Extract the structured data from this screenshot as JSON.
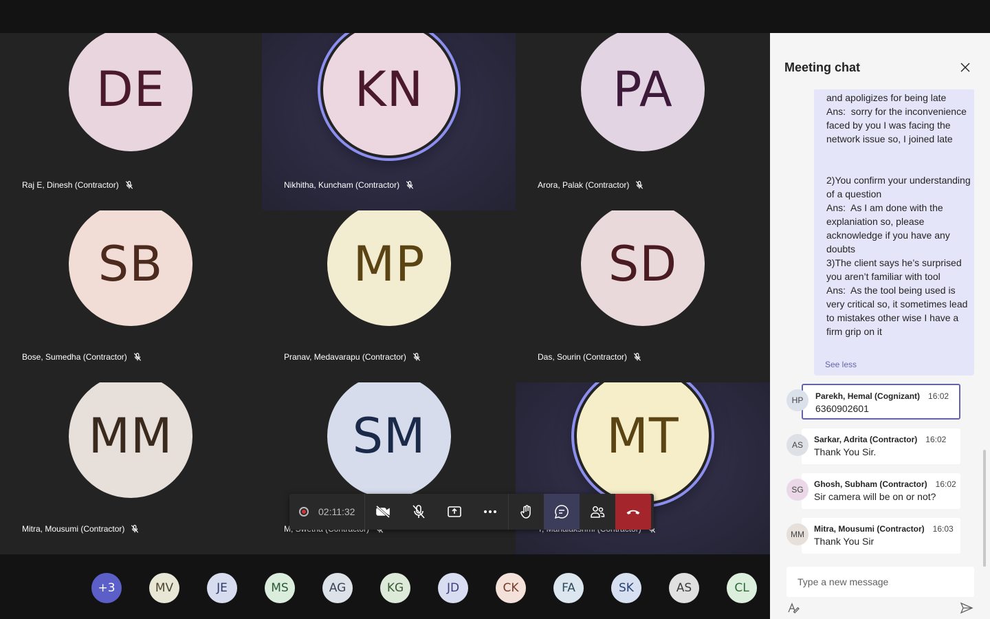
{
  "tiles": [
    {
      "initials": "DE",
      "name": "Raj E, Dinesh (Contractor)",
      "bg": "#e8d5de",
      "fg": "#4a1a2c"
    },
    {
      "initials": "KN",
      "name": "Nikhitha, Kuncham (Contractor)",
      "bg": "#ecd7e1",
      "fg": "#4a1a2c",
      "speaking": true
    },
    {
      "initials": "PA",
      "name": "Arora, Palak (Contractor)",
      "bg": "#e3d4e4",
      "fg": "#3d1a3a"
    },
    {
      "initials": "SB",
      "name": "Bose, Sumedha (Contractor)",
      "bg": "#f2ddd6",
      "fg": "#4d2a1e"
    },
    {
      "initials": "MP",
      "name": "Pranav, Medavarapu (Contractor)",
      "bg": "#f2ecd0",
      "fg": "#5a4413"
    },
    {
      "initials": "SD",
      "name": "Das, Sourin (Contractor)",
      "bg": "#ead9da",
      "fg": "#4a1c22"
    },
    {
      "initials": "MM",
      "name": "Mitra, Mousumi (Contractor)",
      "bg": "#e6dfda",
      "fg": "#3a2a1e"
    },
    {
      "initials": "SM",
      "name": "M, Swetha (Contractor)",
      "bg": "#d6dcec",
      "fg": "#1c2a4a"
    },
    {
      "initials": "MT",
      "name": "T, Mahalakshmi (Contractor)",
      "bg": "#f5eec8",
      "fg": "#5a4413",
      "speaking": true
    }
  ],
  "call_controls": {
    "timer": "02:11:32"
  },
  "roster": [
    {
      "label": "+3",
      "bg": "#5b5fc7",
      "fg": "#ffffff"
    },
    {
      "label": "MV",
      "bg": "#e8e6d5",
      "fg": "#4a4430"
    },
    {
      "label": "JE",
      "bg": "#d8dcef",
      "fg": "#2c3a6a"
    },
    {
      "label": "MS",
      "bg": "#dbeede",
      "fg": "#2d5a36"
    },
    {
      "label": "AG",
      "bg": "#dde1e8",
      "fg": "#3a4454"
    },
    {
      "label": "KG",
      "bg": "#dde9d9",
      "fg": "#3a5a32"
    },
    {
      "label": "JD",
      "bg": "#d9ddf2",
      "fg": "#3a3f7a"
    },
    {
      "label": "CK",
      "bg": "#f3e1da",
      "fg": "#7a3a28"
    },
    {
      "label": "FA",
      "bg": "#dbe6ee",
      "fg": "#2e4a5e"
    },
    {
      "label": "SK",
      "bg": "#d6e0f0",
      "fg": "#2a4272"
    },
    {
      "label": "AS",
      "bg": "#e0e0e0",
      "fg": "#3c3c3c"
    },
    {
      "label": "CL",
      "bg": "#dcefdc",
      "fg": "#2e6a3a"
    }
  ],
  "chat": {
    "title": "Meeting chat",
    "self_message": "and apoligizes for being late\nAns:  sorry for the inconvenience faced by you I was facing the network issue so, I joined late\n\n\n2)You confirm your understanding of a question\nAns:  As I am done with the explaniation so, please acknowledge if you have any doubts\n3)The client says he’s surprised you aren’t familiar with tool\nAns:  As the tool being used is very critical so, it sometimes lead to mistakes other wise I have a firm grip on it",
    "see_less": "See less",
    "messages": [
      {
        "initials": "HP",
        "sender": "Parekh, Hemal (Cognizant)",
        "time": "16:02",
        "text": "6360902601",
        "av_bg": "#dbe1ea"
      },
      {
        "initials": "AS",
        "sender": "Sarkar, Adrita (Contractor)",
        "time": "16:02",
        "text": "Thank You Sir.",
        "av_bg": "#dde1e6"
      },
      {
        "initials": "SG",
        "sender": "Ghosh, Subham (Contractor)",
        "time": "16:02",
        "text": "Sir camera will be on or not?",
        "av_bg": "#ead8e8"
      },
      {
        "initials": "MM",
        "sender": "Mitra, Mousumi (Contractor)",
        "time": "16:03",
        "text": "Thank You Sir",
        "av_bg": "#e6dfda"
      }
    ],
    "compose_placeholder": "Type a new message"
  }
}
